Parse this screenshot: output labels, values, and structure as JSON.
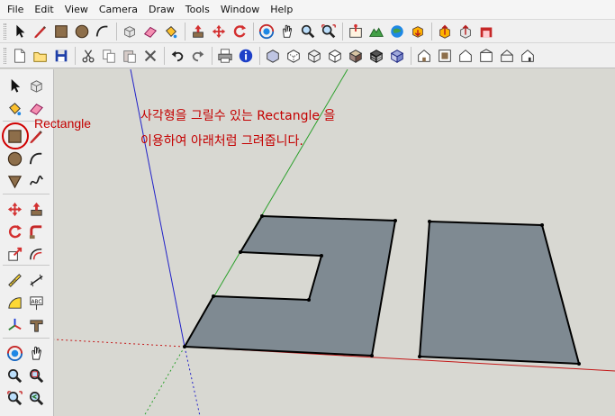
{
  "menu": [
    "File",
    "Edit",
    "View",
    "Camera",
    "Draw",
    "Tools",
    "Window",
    "Help"
  ],
  "toolbar1": [
    "select-icon",
    "pencil-line-icon",
    "rectangle-icon",
    "circle-icon",
    "arc-icon",
    "make-component-icon",
    "eraser-icon",
    "paint-bucket-icon",
    "push-pull-icon",
    "move-icon",
    "rotate-icon",
    "orbit-icon",
    "pan-icon",
    "zoom-icon",
    "zoom-extents-icon",
    "add-location-icon",
    "terrain-icon",
    "preview-google-earth-icon",
    "get-models-icon",
    "share-model-icon",
    "share-component-icon",
    "extension-warehouse-icon"
  ],
  "toolbar2": [
    "new-file-icon",
    "open-file-icon",
    "save-icon",
    "cut-icon",
    "copy-icon",
    "paste-icon",
    "delete-icon",
    "undo-icon",
    "redo-icon",
    "print-icon",
    "model-info-icon",
    "xray-icon",
    "back-edges-icon",
    "wireframe-icon",
    "hidden-line-icon",
    "shaded-icon",
    "shaded-textures-icon",
    "monochrome-icon",
    "iso-view-icon",
    "top-view-icon",
    "front-view-icon",
    "right-view-icon",
    "back-view-icon",
    "left-view-icon"
  ],
  "left_toolbar": [
    [
      "select-icon",
      "make-component-icon"
    ],
    [
      "paint-bucket-icon",
      "eraser-icon"
    ],
    [
      "rectangle-icon",
      "pencil-line-icon"
    ],
    [
      "circle-icon",
      "arc-icon"
    ],
    [
      "polygon-icon",
      "freehand-icon"
    ],
    [
      "move-icon",
      "push-pull-icon"
    ],
    [
      "rotate-icon",
      "follow-me-icon"
    ],
    [
      "scale-icon",
      "offset-icon"
    ],
    [
      "tape-measure-icon",
      "dimension-icon"
    ],
    [
      "protractor-icon",
      "text-icon"
    ],
    [
      "axes-icon",
      "3d-text-icon"
    ],
    [
      "orbit-icon",
      "pan-icon"
    ],
    [
      "zoom-icon",
      "zoom-window-icon"
    ],
    [
      "zoom-extents-icon",
      "previous-view-icon"
    ]
  ],
  "tool_label": "Rectangle",
  "notes": {
    "line1": "사각형을 그릴수 있는 Rectangle 을",
    "line2": "이용하여 아래처럼 그려줍니다."
  },
  "colors": {
    "annotation": "#c40000",
    "face": "#7f8a92",
    "edge": "#000000",
    "axis_red": "#c41818",
    "axis_green": "#2ca02c",
    "axis_blue": "#2020c8"
  }
}
